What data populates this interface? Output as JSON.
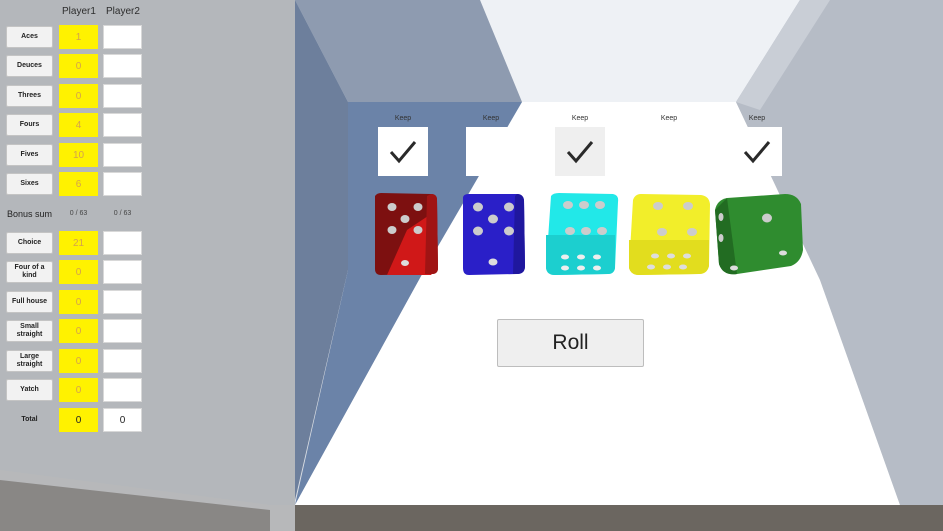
{
  "players": [
    "Player1",
    "Player2"
  ],
  "categories": [
    {
      "label": "Aces",
      "p1": "1",
      "p2": ""
    },
    {
      "label": "Deuces",
      "p1": "0",
      "p2": ""
    },
    {
      "label": "Threes",
      "p1": "0",
      "p2": ""
    },
    {
      "label": "Fours",
      "p1": "4",
      "p2": ""
    },
    {
      "label": "Fives",
      "p1": "10",
      "p2": ""
    },
    {
      "label": "Sixes",
      "p1": "6",
      "p2": ""
    }
  ],
  "bonus": {
    "label": "Bonus sum",
    "p1": "0 / 63",
    "p2": "0 / 63"
  },
  "categories_lower": [
    {
      "label": "Choice",
      "p1": "21",
      "p2": ""
    },
    {
      "label": "Four of a kind",
      "p1": "0",
      "p2": ""
    },
    {
      "label": "Full house",
      "p1": "0",
      "p2": ""
    },
    {
      "label": "Small straight",
      "p1": "0",
      "p2": ""
    },
    {
      "label": "Large straight",
      "p1": "0",
      "p2": ""
    },
    {
      "label": "Yatch",
      "p1": "0",
      "p2": ""
    }
  ],
  "total": {
    "label": "Total",
    "p1": "0",
    "p2": "0"
  },
  "keep": {
    "label": "Keep",
    "states": [
      true,
      false,
      true,
      false,
      true
    ]
  },
  "dice": [
    {
      "color": "red",
      "value": 5
    },
    {
      "color": "blue",
      "value": 5
    },
    {
      "color": "cyan",
      "value": 6
    },
    {
      "color": "yellow",
      "value": 6
    },
    {
      "color": "green",
      "value": 1
    }
  ],
  "roll_button": "Roll",
  "colors": {
    "score_highlight": "#fff200",
    "score_text": "#d4a24c"
  }
}
